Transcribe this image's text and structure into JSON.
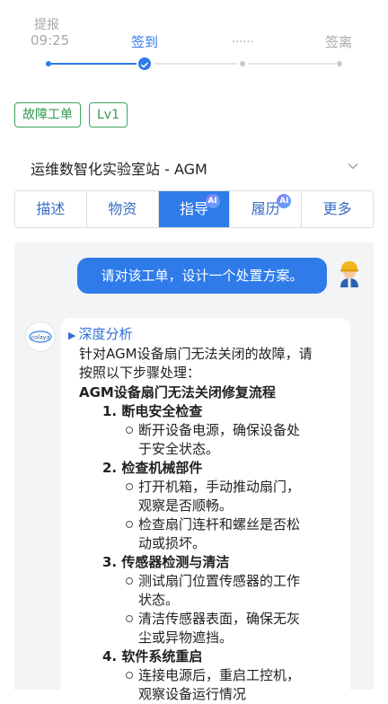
{
  "stepper": {
    "steps": [
      {
        "top": "提报",
        "time": "09:25",
        "state": "done"
      },
      {
        "label": "签到",
        "state": "current"
      },
      {
        "label": "......",
        "state": "pending"
      },
      {
        "label": "签离",
        "state": "pending"
      }
    ]
  },
  "tags": [
    "故障工单",
    "Lv1"
  ],
  "station": {
    "name": "运维数智化实验室站 - AGM"
  },
  "tabs": [
    {
      "label": "描述",
      "ai": false,
      "active": false
    },
    {
      "label": "物资",
      "ai": false,
      "active": false
    },
    {
      "label": "指导",
      "ai": true,
      "active": true
    },
    {
      "label": "履历",
      "ai": true,
      "active": false
    },
    {
      "label": "更多",
      "ai": false,
      "active": false
    }
  ],
  "ai_badge_text": "AI",
  "chat": {
    "user_message": "请对该工单，设计一个处置方案。",
    "bot_logo_text": "colaya",
    "reply": {
      "deep_label": "深度分析",
      "intro_line1": "针对AGM设备扇门无法关闭的故障，请",
      "intro_line2": "按照以下步骤处理：",
      "flow_title": "AGM设备扇门无法关闭修复流程",
      "steps": [
        {
          "title": "1. 断电安全检查",
          "subs": [
            [
              "断开设备电源，确保设备处",
              "于安全状态。"
            ]
          ]
        },
        {
          "title": "2. 检查机械部件",
          "subs": [
            [
              "打开机箱，手动推动扇门，",
              "观察是否顺畅。"
            ],
            [
              "检查扇门连杆和螺丝是否松",
              "动或损坏。"
            ]
          ]
        },
        {
          "title": "3. 传感器检测与清洁",
          "subs": [
            [
              "测试扇门位置传感器的工作",
              "状态。"
            ],
            [
              "清洁传感器表面，确保无灰",
              "尘或异物遮挡。"
            ]
          ]
        },
        {
          "title": "4. 软件系统重启",
          "subs": [
            [
              "连接电源后，重启工控机，",
              "观察设备运行情况"
            ]
          ]
        }
      ]
    }
  },
  "colors": {
    "primary": "#2f7bea",
    "tag_green": "#2f9a4f",
    "muted": "#a8a8a8"
  }
}
